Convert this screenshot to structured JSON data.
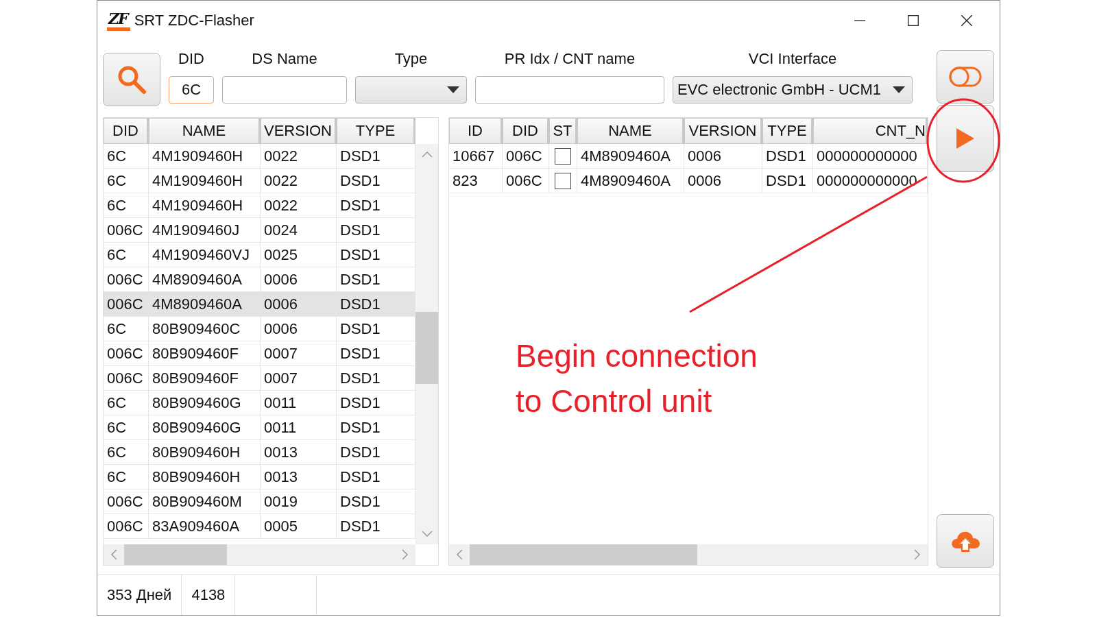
{
  "window": {
    "logo": "ZF",
    "title": "SRT ZDC-Flasher"
  },
  "filters": [
    {
      "label": "DID",
      "kind": "text",
      "value": "6C",
      "focused": true
    },
    {
      "label": "DS Name",
      "kind": "text",
      "focused": false
    },
    {
      "label": "Type",
      "kind": "dropdown",
      "focused": false
    },
    {
      "label": "PR Idx / CNT name",
      "kind": "text",
      "focused": false
    },
    {
      "label": "VCI Interface",
      "kind": "dropdown",
      "value": "EVC electronic GmbH - UCM1",
      "focused": false
    }
  ],
  "left_table": {
    "columns": [
      "DID",
      "NAME",
      "VERSION",
      "TYPE"
    ],
    "rows": [
      {
        "cells": [
          "6C",
          "4M1909460H",
          "0022",
          "DSD1"
        ],
        "selected": false
      },
      {
        "cells": [
          "6C",
          "4M1909460H",
          "0022",
          "DSD1"
        ],
        "selected": false
      },
      {
        "cells": [
          "6C",
          "4M1909460H",
          "0022",
          "DSD1"
        ],
        "selected": false
      },
      {
        "cells": [
          "006C",
          "4M1909460J",
          "0024",
          "DSD1"
        ],
        "selected": false
      },
      {
        "cells": [
          "6C",
          "4M1909460VJ",
          "0025",
          "DSD1"
        ],
        "selected": false
      },
      {
        "cells": [
          "006C",
          "4M8909460A",
          "0006",
          "DSD1"
        ],
        "selected": false
      },
      {
        "cells": [
          "006C",
          "4M8909460A",
          "0006",
          "DSD1"
        ],
        "selected": true
      },
      {
        "cells": [
          "6C",
          "80B909460C",
          "0006",
          "DSD1"
        ],
        "selected": false
      },
      {
        "cells": [
          "006C",
          "80B909460F",
          "0007",
          "DSD1"
        ],
        "selected": false
      },
      {
        "cells": [
          "006C",
          "80B909460F",
          "0007",
          "DSD1"
        ],
        "selected": false
      },
      {
        "cells": [
          "6C",
          "80B909460G",
          "0011",
          "DSD1"
        ],
        "selected": false
      },
      {
        "cells": [
          "6C",
          "80B909460G",
          "0011",
          "DSD1"
        ],
        "selected": false
      },
      {
        "cells": [
          "6C",
          "80B909460H",
          "0013",
          "DSD1"
        ],
        "selected": false
      },
      {
        "cells": [
          "6C",
          "80B909460H",
          "0013",
          "DSD1"
        ],
        "selected": false
      },
      {
        "cells": [
          "006C",
          "80B909460M",
          "0019",
          "DSD1"
        ],
        "selected": false
      },
      {
        "cells": [
          "006C",
          "83A909460A",
          "0005",
          "DSD1"
        ],
        "selected": false
      }
    ]
  },
  "right_table": {
    "columns": [
      {
        "label": "ID",
        "kind": "text"
      },
      {
        "label": "DID",
        "kind": "text"
      },
      {
        "label": "ST",
        "kind": "checkbox"
      },
      {
        "label": "NAME",
        "kind": "text"
      },
      {
        "label": "VERSION",
        "kind": "text"
      },
      {
        "label": "TYPE",
        "kind": "text"
      },
      {
        "label": "CNT_N",
        "kind": "text"
      }
    ],
    "rows": [
      {
        "cells": [
          "10667",
          "006C",
          "",
          "4M8909460A",
          "0006",
          "DSD1",
          "000000000000"
        ],
        "checked": false
      },
      {
        "cells": [
          "823",
          "006C",
          "",
          "4M8909460A",
          "0006",
          "DSD1",
          "000000000000"
        ],
        "checked": false
      }
    ]
  },
  "status_bar": [
    "353 Дней",
    "4138"
  ],
  "annotation": {
    "text": "Begin connection to Control unit"
  }
}
